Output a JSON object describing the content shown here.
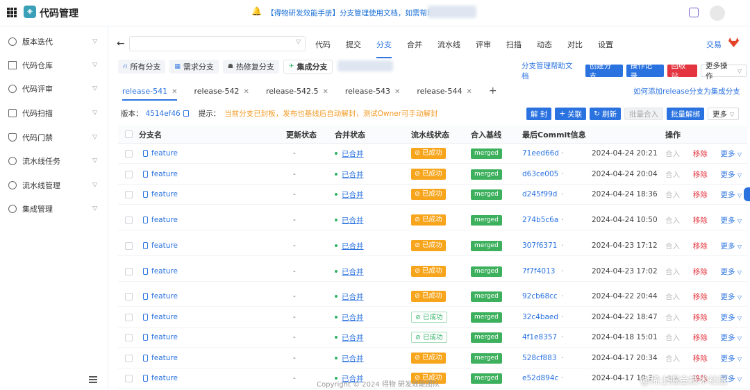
{
  "header": {
    "app_title": "代码管理",
    "logo_glyph": "◈",
    "announcement": "【得物研发效能手册】分支管理使用文档，如需帮助"
  },
  "sidebar": {
    "items": [
      {
        "label": "版本迭代",
        "icon": "iteration-icon"
      },
      {
        "label": "代码仓库",
        "icon": "repo-icon"
      },
      {
        "label": "代码评审",
        "icon": "review-icon"
      },
      {
        "label": "代码扫描",
        "icon": "scan-icon"
      },
      {
        "label": "代码门禁",
        "icon": "shield-icon"
      },
      {
        "label": "流水线任务",
        "icon": "pipeline-task-icon"
      },
      {
        "label": "流水线管理",
        "icon": "pipeline-manage-icon"
      },
      {
        "label": "集成管理",
        "icon": "integration-icon"
      }
    ]
  },
  "nav": {
    "back": "←",
    "tabs": [
      "代码",
      "提交",
      "分支",
      "合并",
      "流水线",
      "评审",
      "扫描",
      "动态",
      "对比",
      "设置"
    ],
    "active_tab": 2,
    "right_link": "交易"
  },
  "filters": {
    "chips": [
      {
        "label": "所有分支",
        "icon": "⛙"
      },
      {
        "label": "需求分支",
        "icon": "▦"
      },
      {
        "label": "热修复分支",
        "icon": "☗"
      },
      {
        "label": "集成分支",
        "icon": "✈"
      }
    ],
    "active": 3
  },
  "actions": {
    "help": "分支管理帮助文档",
    "create": "创建分支",
    "records": "操作记录",
    "recycle": "回收站",
    "more": "更多操作"
  },
  "release_tabs": {
    "tabs": [
      "release-541",
      "release-542",
      "release-542.5",
      "release-543",
      "release-544"
    ],
    "active": 0,
    "add": "+",
    "help_link": "如何添加release分支为集成分支"
  },
  "info": {
    "version_label": "版本：",
    "version_value": "4514ef46",
    "tip_label": "提示：",
    "tip_text": "当前分支已封板，发布也基线后自动解封，测试Owner可手动解封"
  },
  "toolbar": {
    "unseal": "解 封",
    "associate": "关联",
    "refresh": "刷新",
    "batch_merge": "批量合入",
    "batch_unbind": "批量解绑",
    "more": "更多"
  },
  "table": {
    "headers": [
      "分支名",
      "更新状态",
      "合并状态",
      "流水线状态",
      "合入基线",
      "最后Commit信息",
      "操作"
    ],
    "rows": [
      {
        "name": "feature",
        "update": "-",
        "merge": "已合并",
        "pipeline": "已成功",
        "pipeline_style": "orange",
        "base": "merged",
        "hash": "71eed66d",
        "date": "2024-04-24 20:21"
      },
      {
        "name": "feature",
        "update": "-",
        "merge": "已合并",
        "pipeline": "已成功",
        "pipeline_style": "orange",
        "base": "merged",
        "hash": "d63ce005",
        "date": "2024-04-24 20:04"
      },
      {
        "name": "feature",
        "update": "-",
        "merge": "已合并",
        "pipeline": "已成功",
        "pipeline_style": "orange",
        "base": "merged",
        "hash": "d245f99d",
        "date": "2024-04-24 18:36"
      },
      {
        "name": "feature",
        "update": "-",
        "merge": "已合并",
        "pipeline": "已成功",
        "pipeline_style": "orange",
        "base": "merged",
        "hash": "274b5c6a",
        "date": "2024-04-24 10:50"
      },
      {
        "name": "feature",
        "update": "-",
        "merge": "已合并",
        "pipeline": "已成功",
        "pipeline_style": "orange",
        "base": "merged",
        "hash": "307f6371",
        "date": "2024-04-23 17:12"
      },
      {
        "name": "feature",
        "update": "-",
        "merge": "已合并",
        "pipeline": "已成功",
        "pipeline_style": "orange",
        "base": "merged",
        "hash": "7f7f4013",
        "date": "2024-04-23 17:02"
      },
      {
        "name": "feature",
        "update": "-",
        "merge": "已合并",
        "pipeline": "已成功",
        "pipeline_style": "orange",
        "base": "merged",
        "hash": "92cb68cc",
        "date": "2024-04-22 20:44"
      },
      {
        "name": "feature",
        "update": "-",
        "merge": "已合并",
        "pipeline": "已成功",
        "pipeline_style": "green",
        "base": "merged",
        "hash": "32c4baed",
        "date": "2024-04-22 18:47"
      },
      {
        "name": "feature",
        "update": "-",
        "merge": "已合并",
        "pipeline": "已成功",
        "pipeline_style": "green",
        "base": "merged",
        "hash": "4f1e8357",
        "date": "2024-04-18 15:01"
      },
      {
        "name": "feature",
        "update": "-",
        "merge": "已合并",
        "pipeline": "已成功",
        "pipeline_style": "orange",
        "base": "merged",
        "hash": "528cf883",
        "date": "2024-04-17 20:34"
      },
      {
        "name": "feature",
        "update": "-",
        "merge": "已合并",
        "pipeline": "已成功",
        "pipeline_style": "orange",
        "base": "merged",
        "hash": "e52d894c",
        "date": "2024-04-17 10:3"
      }
    ],
    "ops": {
      "merge": "合入",
      "remove": "移除",
      "more": "更多"
    }
  },
  "footer": "Copyright © 2024 得物 研发效能团队",
  "watermark": "@稀土掘金技术社区"
}
